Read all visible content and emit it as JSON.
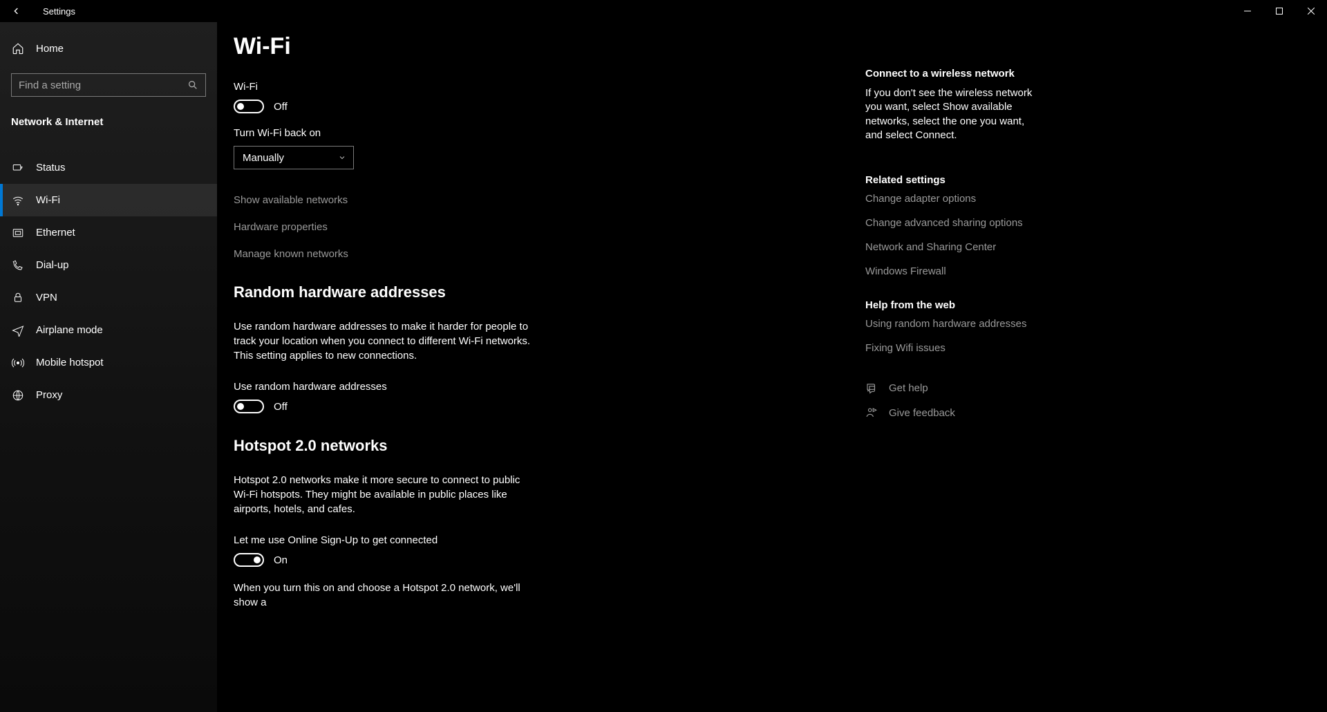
{
  "window": {
    "title": "Settings"
  },
  "sidebar": {
    "home": "Home",
    "search_placeholder": "Find a setting",
    "category": "Network & Internet",
    "items": [
      {
        "label": "Status"
      },
      {
        "label": "Wi-Fi"
      },
      {
        "label": "Ethernet"
      },
      {
        "label": "Dial-up"
      },
      {
        "label": "VPN"
      },
      {
        "label": "Airplane mode"
      },
      {
        "label": "Mobile hotspot"
      },
      {
        "label": "Proxy"
      }
    ]
  },
  "main": {
    "title": "Wi-Fi",
    "wifi": {
      "label": "Wi-Fi",
      "state": "Off"
    },
    "turn_back": {
      "label": "Turn Wi-Fi back on",
      "value": "Manually"
    },
    "links": {
      "show_networks": "Show available networks",
      "hw_props": "Hardware properties",
      "manage_known": "Manage known networks"
    },
    "random": {
      "heading": "Random hardware addresses",
      "para": "Use random hardware addresses to make it harder for people to track your location when you connect to different Wi-Fi networks. This setting applies to new connections.",
      "toggle_label": "Use random hardware addresses",
      "state": "Off"
    },
    "hotspot": {
      "heading": "Hotspot 2.0 networks",
      "para": "Hotspot 2.0 networks make it more secure to connect to public Wi-Fi hotspots. They might be available in public places like airports, hotels, and cafes.",
      "toggle_label": "Let me use Online Sign-Up to get connected",
      "state": "On",
      "after": "When you turn this on and choose a Hotspot 2.0 network, we'll show a"
    }
  },
  "right": {
    "connect": {
      "title": "Connect to a wireless network",
      "para": "If you don't see the wireless network you want, select Show available networks, select the one you want, and select Connect."
    },
    "related": {
      "title": "Related settings",
      "links": [
        "Change adapter options",
        "Change advanced sharing options",
        "Network and Sharing Center",
        "Windows Firewall"
      ]
    },
    "help": {
      "title": "Help from the web",
      "links": [
        "Using random hardware addresses",
        "Fixing Wifi issues"
      ]
    },
    "actions": {
      "get_help": "Get help",
      "feedback": "Give feedback"
    }
  }
}
